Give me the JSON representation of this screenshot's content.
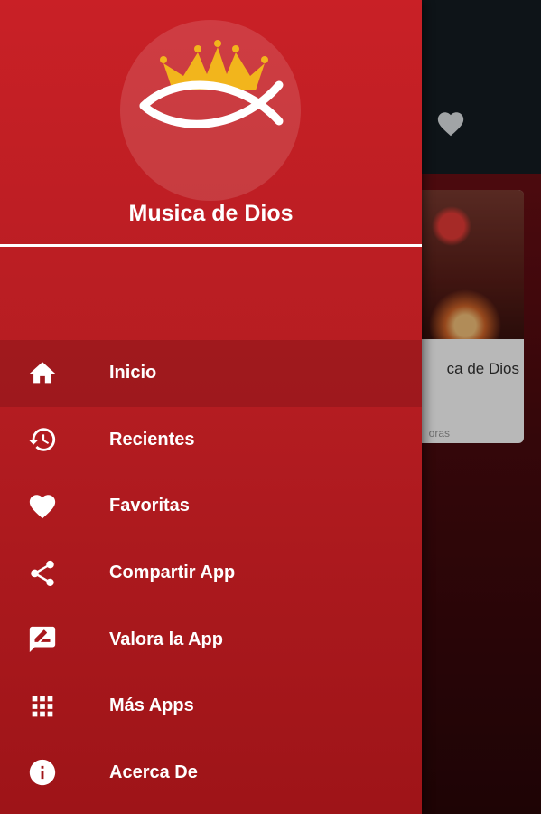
{
  "app": {
    "title": "Musica de Dios"
  },
  "background": {
    "card_title": "ca de Dios",
    "card_subtitle": "oras"
  },
  "menu": [
    {
      "label": "Inicio",
      "icon": "home-icon",
      "active": true
    },
    {
      "label": "Recientes",
      "icon": "history-icon",
      "active": false
    },
    {
      "label": "Favoritas",
      "icon": "heart-icon",
      "active": false
    },
    {
      "label": "Compartir App",
      "icon": "share-icon",
      "active": false
    },
    {
      "label": "Valora la App",
      "icon": "rate-icon",
      "active": false
    },
    {
      "label": "Más Apps",
      "icon": "apps-grid-icon",
      "active": false
    },
    {
      "label": "Acerca De",
      "icon": "info-icon",
      "active": false
    }
  ],
  "colors": {
    "drawer_top": "#c92026",
    "drawer_bottom": "#9e1418",
    "crown": "#f2b51c",
    "text": "#ffffff"
  }
}
